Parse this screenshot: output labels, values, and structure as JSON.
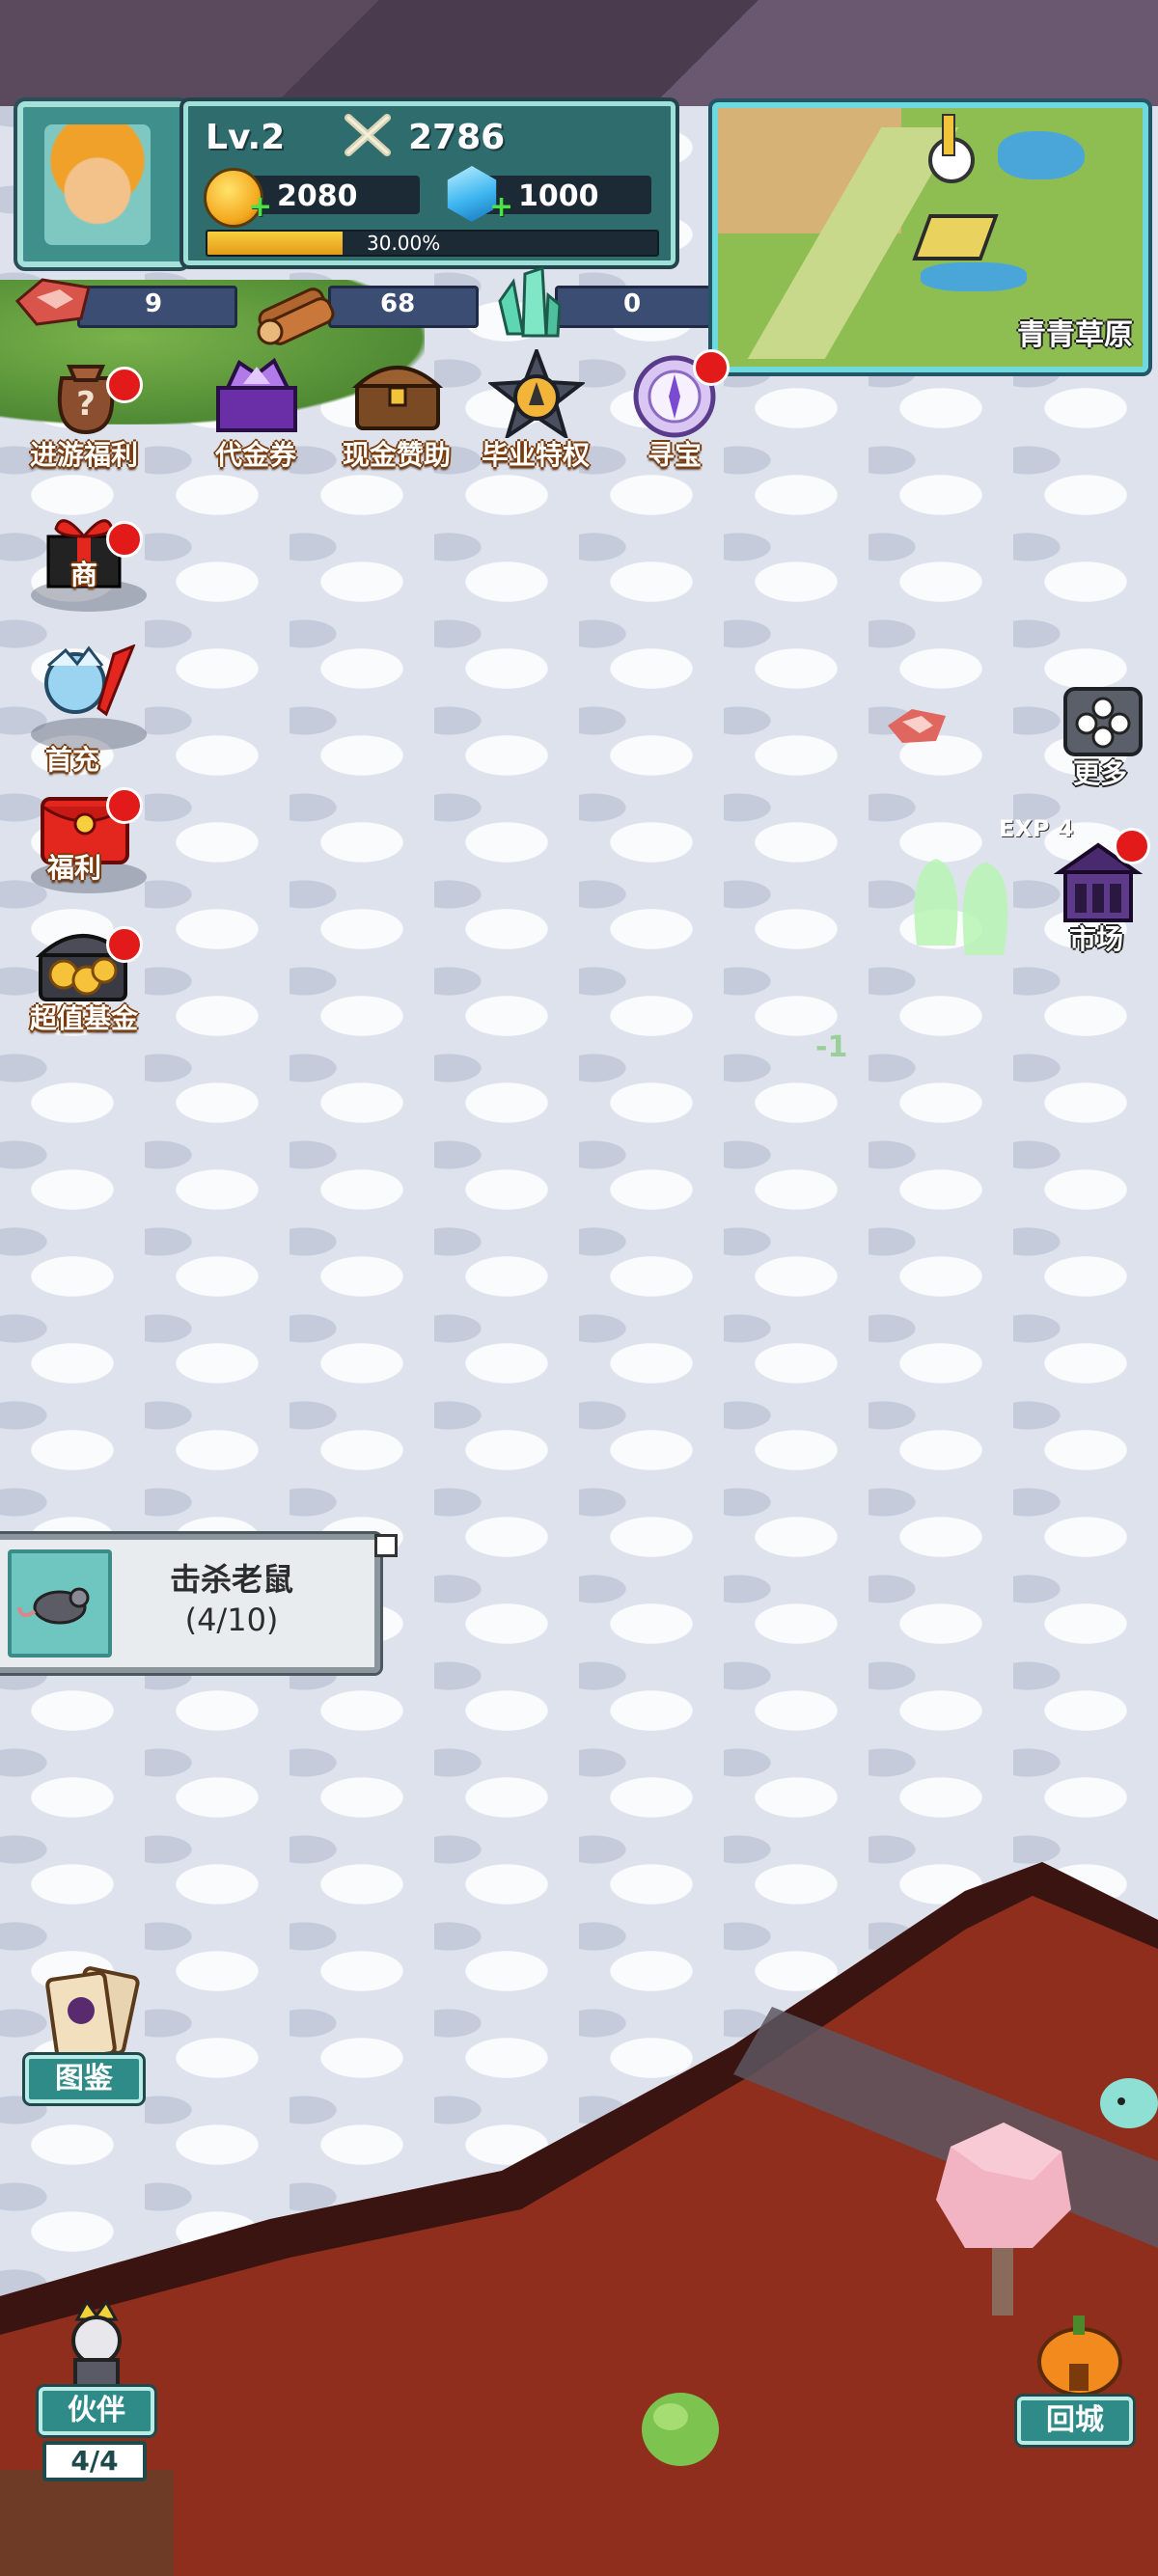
{
  "player": {
    "level": "Lv.2",
    "power": "2786",
    "gold": "2080",
    "gems": "1000",
    "exp_percent": "30.00%",
    "exp_fraction": 0.3
  },
  "resources": {
    "meat": "9",
    "wood": "68",
    "crystal": "0"
  },
  "minimap": {
    "area_name": "青青草原"
  },
  "top_menu": [
    {
      "label": "进游福利",
      "icon": "lucky-bag-icon",
      "badge": true
    },
    {
      "label": "代金券",
      "icon": "gem-box-icon",
      "badge": false
    },
    {
      "label": "现金赞助",
      "icon": "treasure-chest-icon",
      "badge": false
    },
    {
      "label": "毕业特权",
      "icon": "star-badge-icon",
      "badge": false
    },
    {
      "label": "寻宝",
      "icon": "compass-icon",
      "badge": true
    }
  ],
  "left_menu": [
    {
      "label": "商",
      "icon": "gift-box-icon",
      "badge": true
    },
    {
      "label": "首充",
      "icon": "hero-sword-icon",
      "badge": false
    },
    {
      "label": "福利",
      "icon": "red-envelope-icon",
      "badge": true
    },
    {
      "label": "超值基金",
      "icon": "gold-chest-icon",
      "badge": true
    }
  ],
  "right_menu": {
    "more": "更多",
    "market": "市场"
  },
  "floating": {
    "exp_popup": "EXP 4",
    "damage": "-1"
  },
  "quest": {
    "title": "击杀老鼠",
    "progress": "(4/10)"
  },
  "bottom": {
    "codex": "图鉴",
    "partner": "伙伴",
    "partner_count": "4/4",
    "return_city": "回城"
  },
  "colors": {
    "teal_panel": "#2e6c6e",
    "teal_border": "#9fe0d8",
    "badge_red": "#e31a1a",
    "exp_gold": "#f6cf3f",
    "lava": "#8f2e1c"
  }
}
